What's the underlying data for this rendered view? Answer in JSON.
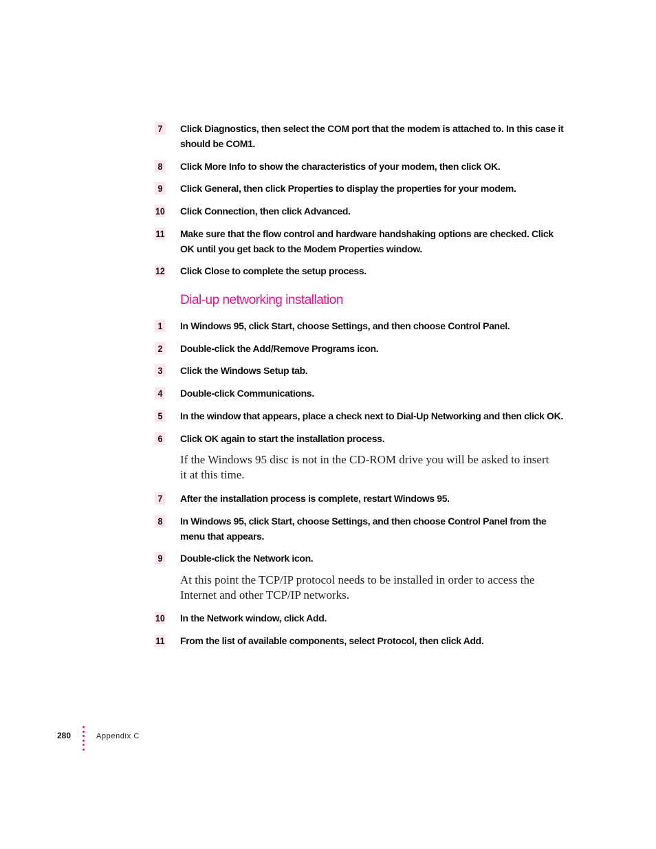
{
  "steps_top": [
    {
      "num": "7",
      "text": "Click Diagnostics, then select the COM port that the modem is attached to. In this case it should be COM1."
    },
    {
      "num": "8",
      "text": "Click More Info to show the characteristics of your modem, then click OK."
    },
    {
      "num": "9",
      "text": "Click General, then click Properties to display the properties for your modem."
    },
    {
      "num": "10",
      "text": "Click Connection, then click Advanced."
    },
    {
      "num": "11",
      "text": "Make sure that the flow control and hardware handshaking options are checked. Click OK until you get back to the Modem Properties window."
    },
    {
      "num": "12",
      "text": "Click Close to complete the setup process."
    }
  ],
  "section": {
    "heading": "Dial-up networking installation",
    "accent_color": "#e0168a",
    "steps_a": [
      {
        "num": "1",
        "text": "In Windows 95, click Start, choose Settings, and then choose Control Panel."
      },
      {
        "num": "2",
        "text": "Double-click the Add/Remove Programs icon."
      },
      {
        "num": "3",
        "text": "Click the Windows Setup tab."
      },
      {
        "num": "4",
        "text": "Double-click Communications."
      },
      {
        "num": "5",
        "text": "In the window that appears, place a check next to Dial-Up Networking and then click OK."
      },
      {
        "num": "6",
        "text": "Click OK again to start the installation process."
      }
    ],
    "note_1": "If the Windows 95 disc is not in the CD-ROM drive you will be asked to insert it at this time.",
    "steps_b": [
      {
        "num": "7",
        "text": "After the installation process is complete, restart Windows 95."
      },
      {
        "num": "8",
        "text": "In Windows 95, click Start, choose Settings, and then choose Control Panel from the menu that appears."
      },
      {
        "num": "9",
        "text": "Double-click the Network icon."
      }
    ],
    "note_2": "At this point the TCP/IP protocol needs to be installed in order to access the Internet and other TCP/IP networks.",
    "steps_c": [
      {
        "num": "10",
        "text": "In the Network window, click Add."
      },
      {
        "num": "11",
        "text": "From the list of available components, select Protocol, then click Add."
      }
    ]
  },
  "footer": {
    "page_number": "280",
    "section_label": "Appendix C"
  }
}
